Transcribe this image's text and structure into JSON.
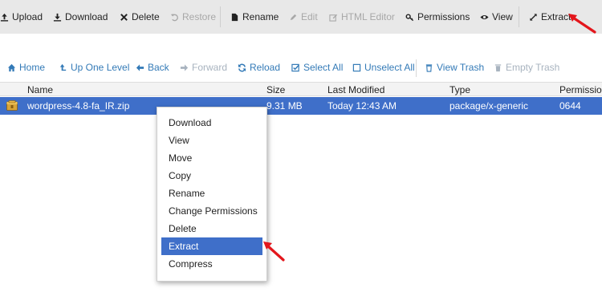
{
  "toolbar": {
    "upload": "Upload",
    "download": "Download",
    "delete": "Delete",
    "restore": "Restore",
    "rename": "Rename",
    "edit": "Edit",
    "html_editor": "HTML Editor",
    "permissions": "Permissions",
    "view": "View",
    "extract": "Extract"
  },
  "nav": {
    "home": "Home",
    "up_one_level": "Up One Level",
    "back": "Back",
    "forward": "Forward",
    "reload": "Reload",
    "select_all": "Select All",
    "unselect_all": "Unselect All",
    "view_trash": "View Trash",
    "empty_trash": "Empty Trash"
  },
  "table": {
    "columns": [
      "Name",
      "Size",
      "Last Modified",
      "Type",
      "Permission"
    ],
    "rows": [
      {
        "name": "wordpress-4.8-fa_IR.zip",
        "size": "9.31 MB",
        "modified": "Today 12:43 AM",
        "type": "package/x-generic",
        "perms": "0644"
      }
    ]
  },
  "context_menu": {
    "items": [
      "Download",
      "View",
      "Move",
      "Copy",
      "Rename",
      "Change Permissions",
      "Delete",
      "Extract",
      "Compress"
    ],
    "highlighted": "Extract"
  },
  "colors": {
    "accent": "#3f6fc9",
    "link": "#337ab7",
    "arrow": "#e3161c",
    "toolbar_bg": "#e8e8e8"
  }
}
